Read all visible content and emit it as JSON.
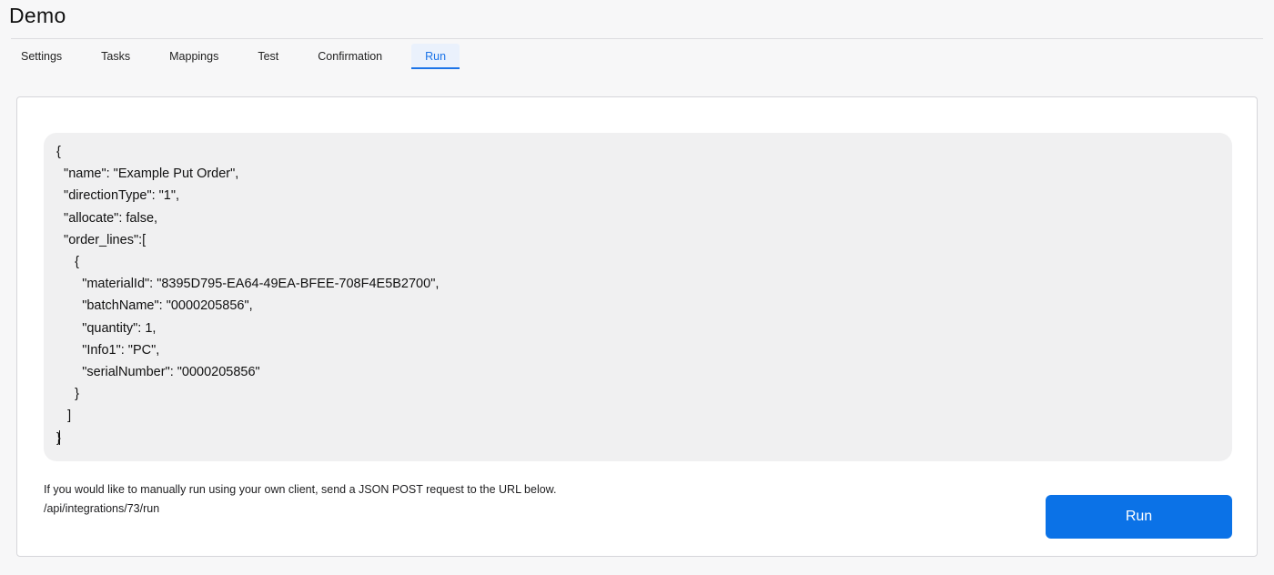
{
  "header": {
    "title": "Demo"
  },
  "tabs": [
    {
      "label": "Settings",
      "active": false
    },
    {
      "label": "Tasks",
      "active": false
    },
    {
      "label": "Mappings",
      "active": false
    },
    {
      "label": "Test",
      "active": false
    },
    {
      "label": "Confirmation",
      "active": false
    },
    {
      "label": "Run",
      "active": true
    }
  ],
  "editor": {
    "content": "{\n  \"name\": \"Example Put Order\",\n  \"directionType\": \"1\",\n  \"allocate\": false,\n  \"order_lines\":[\n     {\n       \"materialId\": \"8395D795-EA64-49EA-BFEE-708F4E5B2700\",\n       \"batchName\": \"0000205856\",\n       \"quantity\": 1,\n       \"Info1\": \"PC\",\n       \"serialNumber\": \"0000205856\"\n     }\n   ]\n}"
  },
  "info": {
    "instructions": "If you would like to manually run using your own client, send a JSON POST request to the URL below.",
    "url": "/api/integrations/73/run"
  },
  "actions": {
    "run_label": "Run"
  },
  "colors": {
    "accent": "#1a73e8",
    "run_button": "#0b72e7",
    "editor_bg": "#f0f0f1"
  }
}
